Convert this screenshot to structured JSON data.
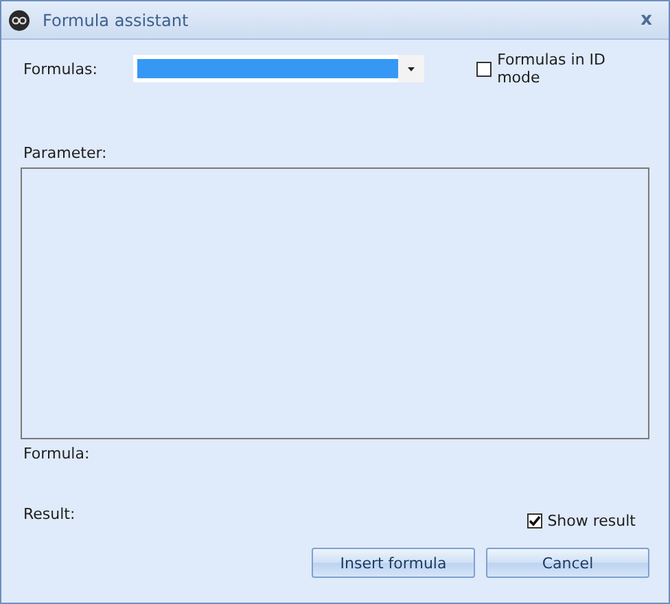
{
  "window": {
    "title": "Formula assistant",
    "close": "x"
  },
  "formulas": {
    "label": "Formulas:",
    "highlighted": true
  },
  "id_mode": {
    "label": "Formulas in ID mode",
    "checked": false
  },
  "parameter": {
    "label": "Parameter:"
  },
  "formula": {
    "label": "Formula:"
  },
  "result": {
    "label": "Result:"
  },
  "show_result": {
    "label": "Show result",
    "checked": true
  },
  "buttons": [
    "Insert formula",
    "Cancel"
  ]
}
